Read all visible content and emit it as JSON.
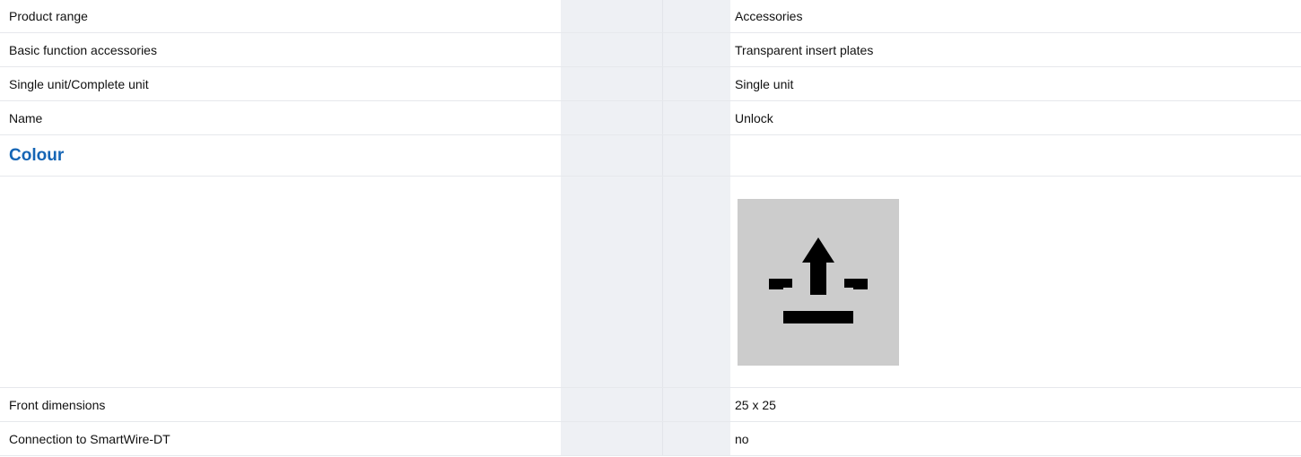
{
  "rows": [
    {
      "label": "Product range",
      "value": "Accessories"
    },
    {
      "label": "Basic function accessories",
      "value": "Transparent insert plates"
    },
    {
      "label": "Single unit/Complete unit",
      "value": "Single unit"
    },
    {
      "label": "Name",
      "value": "Unlock"
    }
  ],
  "section": {
    "heading": "Colour"
  },
  "colour": {
    "swatch_color": "#cccccc",
    "icon": "unlock-arrow-up-tray-icon"
  },
  "rows_after": [
    {
      "label": "Front dimensions",
      "value": "25 x 25"
    },
    {
      "label": "Connection to SmartWire-DT",
      "value": "no"
    }
  ],
  "colors": {
    "heading": "#1565b5",
    "column_shade": "#eef0f4",
    "row_border": "#e6e8ec"
  }
}
